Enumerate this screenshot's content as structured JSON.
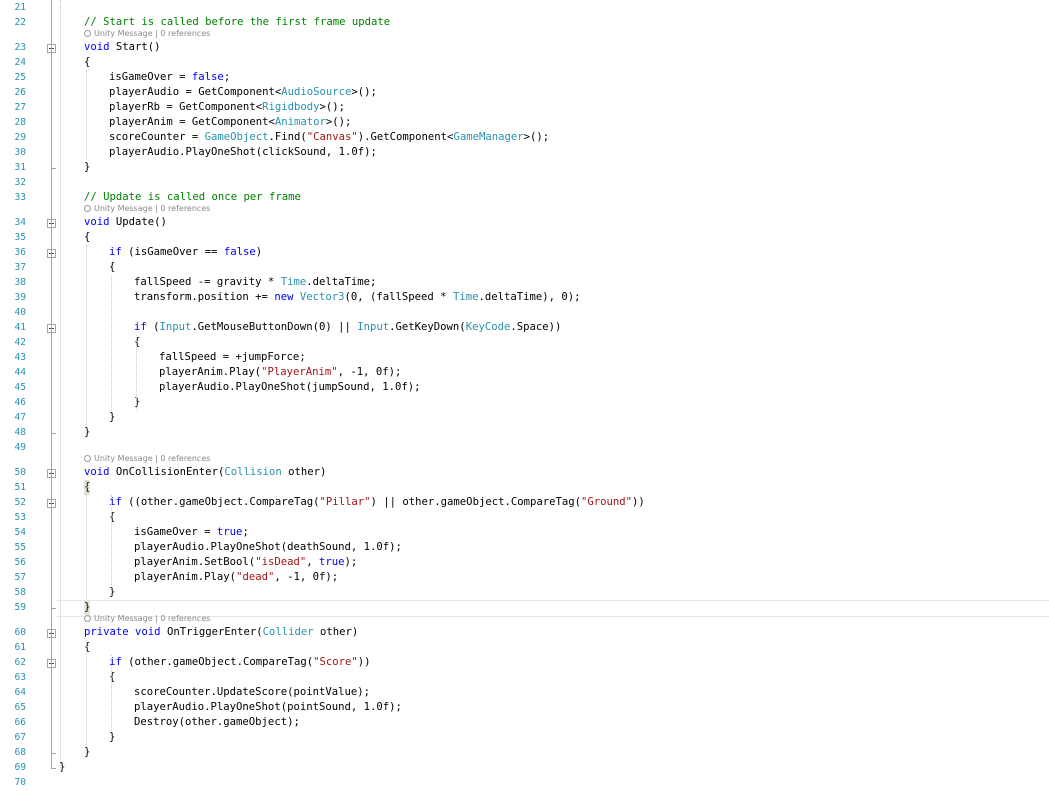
{
  "editor": {
    "colors": {
      "keyword": "#0000ff",
      "type": "#2b91af",
      "string": "#a31515",
      "comment": "#008000",
      "lineNumber": "#2b91af",
      "codelens": "#8a8a8a"
    },
    "codelens_label": "Unity Message | 0 references",
    "lines": [
      {
        "n": "21",
        "indent": 0,
        "tokens": []
      },
      {
        "n": "22",
        "indent": 0,
        "tokens": [
          [
            "com",
            "// Start is called before the first frame update"
          ]
        ],
        "lens": true
      },
      {
        "n": "23",
        "indent": 0,
        "fold": "open",
        "tokens": [
          [
            "kw",
            "void"
          ],
          [
            "plain",
            " Start()"
          ]
        ]
      },
      {
        "n": "24",
        "indent": 0,
        "tokens": [
          [
            "plain",
            "{"
          ]
        ]
      },
      {
        "n": "25",
        "indent": 1,
        "tokens": [
          [
            "plain",
            "isGameOver = "
          ],
          [
            "kw",
            "false"
          ],
          [
            "plain",
            ";"
          ]
        ]
      },
      {
        "n": "26",
        "indent": 1,
        "tokens": [
          [
            "plain",
            "playerAudio = GetComponent<"
          ],
          [
            "type",
            "AudioSource"
          ],
          [
            "plain",
            ">();"
          ]
        ]
      },
      {
        "n": "27",
        "indent": 1,
        "tokens": [
          [
            "plain",
            "playerRb = GetComponent<"
          ],
          [
            "type",
            "Rigidbody"
          ],
          [
            "plain",
            ">();"
          ]
        ]
      },
      {
        "n": "28",
        "indent": 1,
        "tokens": [
          [
            "plain",
            "playerAnim = GetComponent<"
          ],
          [
            "type",
            "Animator"
          ],
          [
            "plain",
            ">();"
          ]
        ]
      },
      {
        "n": "29",
        "indent": 1,
        "tokens": [
          [
            "plain",
            "scoreCounter = "
          ],
          [
            "type",
            "GameObject"
          ],
          [
            "plain",
            ".Find("
          ],
          [
            "str",
            "\"Canvas\""
          ],
          [
            "plain",
            ").GetComponent<"
          ],
          [
            "type",
            "GameManager"
          ],
          [
            "plain",
            ">();"
          ]
        ]
      },
      {
        "n": "30",
        "indent": 1,
        "tokens": [
          [
            "plain",
            "playerAudio.PlayOneShot(clickSound, 1.0f);"
          ]
        ]
      },
      {
        "n": "31",
        "indent": 0,
        "tokens": [
          [
            "plain",
            "}"
          ]
        ]
      },
      {
        "n": "32",
        "indent": 0,
        "tokens": []
      },
      {
        "n": "33",
        "indent": 0,
        "tokens": [
          [
            "com",
            "// Update is called once per frame"
          ]
        ],
        "lens": true
      },
      {
        "n": "34",
        "indent": 0,
        "fold": "open",
        "tokens": [
          [
            "kw",
            "void"
          ],
          [
            "plain",
            " Update()"
          ]
        ]
      },
      {
        "n": "35",
        "indent": 0,
        "tokens": [
          [
            "plain",
            "{"
          ]
        ]
      },
      {
        "n": "36",
        "indent": 1,
        "fold": "open",
        "tokens": [
          [
            "kw",
            "if"
          ],
          [
            "plain",
            " (isGameOver == "
          ],
          [
            "kw",
            "false"
          ],
          [
            "plain",
            ")"
          ]
        ]
      },
      {
        "n": "37",
        "indent": 1,
        "tokens": [
          [
            "plain",
            "{"
          ]
        ]
      },
      {
        "n": "38",
        "indent": 2,
        "tokens": [
          [
            "plain",
            "fallSpeed -= gravity * "
          ],
          [
            "type",
            "Time"
          ],
          [
            "plain",
            ".deltaTime;"
          ]
        ]
      },
      {
        "n": "39",
        "indent": 2,
        "tokens": [
          [
            "plain",
            "transform.position += "
          ],
          [
            "kw",
            "new"
          ],
          [
            "plain",
            " "
          ],
          [
            "type",
            "Vector3"
          ],
          [
            "plain",
            "(0, (fallSpeed * "
          ],
          [
            "type",
            "Time"
          ],
          [
            "plain",
            ".deltaTime), 0);"
          ]
        ]
      },
      {
        "n": "40",
        "indent": 2,
        "tokens": []
      },
      {
        "n": "41",
        "indent": 2,
        "fold": "open",
        "tokens": [
          [
            "kw",
            "if"
          ],
          [
            "plain",
            " ("
          ],
          [
            "type",
            "Input"
          ],
          [
            "plain",
            ".GetMouseButtonDown(0) || "
          ],
          [
            "type",
            "Input"
          ],
          [
            "plain",
            ".GetKeyDown("
          ],
          [
            "type",
            "KeyCode"
          ],
          [
            "plain",
            ".Space))"
          ]
        ]
      },
      {
        "n": "42",
        "indent": 2,
        "tokens": [
          [
            "plain",
            "{"
          ]
        ]
      },
      {
        "n": "43",
        "indent": 3,
        "tokens": [
          [
            "plain",
            "fallSpeed = +jumpForce;"
          ]
        ]
      },
      {
        "n": "44",
        "indent": 3,
        "tokens": [
          [
            "plain",
            "playerAnim.Play("
          ],
          [
            "str",
            "\"PlayerAnim\""
          ],
          [
            "plain",
            ", -1, 0f);"
          ]
        ]
      },
      {
        "n": "45",
        "indent": 3,
        "tokens": [
          [
            "plain",
            "playerAudio.PlayOneShot(jumpSound, 1.0f);"
          ]
        ]
      },
      {
        "n": "46",
        "indent": 2,
        "tokens": [
          [
            "plain",
            "}"
          ]
        ]
      },
      {
        "n": "47",
        "indent": 1,
        "tokens": [
          [
            "plain",
            "}"
          ]
        ]
      },
      {
        "n": "48",
        "indent": 0,
        "tokens": [
          [
            "plain",
            "}"
          ]
        ]
      },
      {
        "n": "49",
        "indent": 0,
        "tokens": [],
        "lens": true
      },
      {
        "n": "50",
        "indent": 0,
        "fold": "open",
        "tokens": [
          [
            "kw",
            "void"
          ],
          [
            "plain",
            " OnCollisionEnter("
          ],
          [
            "type",
            "Collision"
          ],
          [
            "plain",
            " other)"
          ]
        ]
      },
      {
        "n": "51",
        "indent": 0,
        "tokens": [
          [
            "plain",
            "{"
          ]
        ],
        "braceHL": true
      },
      {
        "n": "52",
        "indent": 1,
        "fold": "open",
        "tokens": [
          [
            "kw",
            "if"
          ],
          [
            "plain",
            " ((other.gameObject.CompareTag("
          ],
          [
            "str",
            "\"Pillar\""
          ],
          [
            "plain",
            ") || other.gameObject.CompareTag("
          ],
          [
            "str",
            "\"Ground\""
          ],
          [
            "plain",
            "))"
          ]
        ]
      },
      {
        "n": "53",
        "indent": 1,
        "tokens": [
          [
            "plain",
            "{"
          ]
        ]
      },
      {
        "n": "54",
        "indent": 2,
        "tokens": [
          [
            "plain",
            "isGameOver = "
          ],
          [
            "kw",
            "true"
          ],
          [
            "plain",
            ";"
          ]
        ]
      },
      {
        "n": "55",
        "indent": 2,
        "tokens": [
          [
            "plain",
            "playerAudio.PlayOneShot(deathSound, 1.0f);"
          ]
        ]
      },
      {
        "n": "56",
        "indent": 2,
        "tokens": [
          [
            "plain",
            "playerAnim.SetBool("
          ],
          [
            "str",
            "\"isDead\""
          ],
          [
            "plain",
            ", "
          ],
          [
            "kw",
            "true"
          ],
          [
            "plain",
            ");"
          ]
        ]
      },
      {
        "n": "57",
        "indent": 2,
        "tokens": [
          [
            "plain",
            "playerAnim.Play("
          ],
          [
            "str",
            "\"dead\""
          ],
          [
            "plain",
            ", -1, 0f);"
          ]
        ]
      },
      {
        "n": "58",
        "indent": 1,
        "tokens": [
          [
            "plain",
            "}"
          ]
        ]
      },
      {
        "n": "59",
        "indent": 0,
        "tokens": [
          [
            "plain",
            "}"
          ]
        ],
        "braceHL": true,
        "current": true,
        "lens": true
      },
      {
        "n": "60",
        "indent": 0,
        "fold": "open",
        "tokens": [
          [
            "kw",
            "private"
          ],
          [
            "plain",
            " "
          ],
          [
            "kw",
            "void"
          ],
          [
            "plain",
            " OnTriggerEnter("
          ],
          [
            "type",
            "Collider"
          ],
          [
            "plain",
            " other)"
          ]
        ]
      },
      {
        "n": "61",
        "indent": 0,
        "tokens": [
          [
            "plain",
            "{"
          ]
        ]
      },
      {
        "n": "62",
        "indent": 1,
        "fold": "open",
        "tokens": [
          [
            "kw",
            "if"
          ],
          [
            "plain",
            " (other.gameObject.CompareTag("
          ],
          [
            "str",
            "\"Score\""
          ],
          [
            "plain",
            "))"
          ]
        ]
      },
      {
        "n": "63",
        "indent": 1,
        "tokens": [
          [
            "plain",
            "{"
          ]
        ]
      },
      {
        "n": "64",
        "indent": 2,
        "tokens": [
          [
            "plain",
            "scoreCounter.UpdateScore(pointValue);"
          ]
        ]
      },
      {
        "n": "65",
        "indent": 2,
        "tokens": [
          [
            "plain",
            "playerAudio.PlayOneShot(pointSound, 1.0f);"
          ]
        ]
      },
      {
        "n": "66",
        "indent": 2,
        "tokens": [
          [
            "plain",
            "Destroy(other.gameObject);"
          ]
        ]
      },
      {
        "n": "67",
        "indent": 1,
        "tokens": [
          [
            "plain",
            "}"
          ]
        ]
      },
      {
        "n": "68",
        "indent": 0,
        "tokens": [
          [
            "plain",
            "}"
          ]
        ]
      },
      {
        "n": "69",
        "indent": -1,
        "tokens": [
          [
            "plain",
            "}"
          ]
        ]
      },
      {
        "n": "70",
        "indent": 0,
        "tokens": []
      }
    ]
  }
}
